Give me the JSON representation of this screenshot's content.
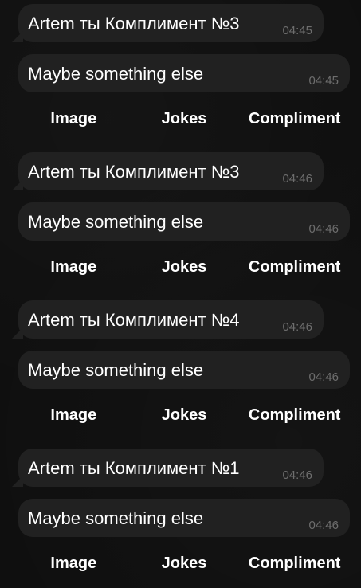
{
  "groups": [
    {
      "compliment": {
        "text": "Artem ты Комплимент №3",
        "time": "04:45"
      },
      "followup": {
        "text": "Maybe something else",
        "time": "04:45"
      },
      "buttons": [
        "Image",
        "Jokes",
        "Compliment"
      ]
    },
    {
      "compliment": {
        "text": "Artem ты Комплимент №3",
        "time": "04:46"
      },
      "followup": {
        "text": "Maybe something else",
        "time": "04:46"
      },
      "buttons": [
        "Image",
        "Jokes",
        "Compliment"
      ]
    },
    {
      "compliment": {
        "text": "Artem ты Комплимент №4",
        "time": "04:46"
      },
      "followup": {
        "text": "Maybe something else",
        "time": "04:46"
      },
      "buttons": [
        "Image",
        "Jokes",
        "Compliment"
      ]
    },
    {
      "compliment": {
        "text": "Artem ты Комплимент №1",
        "time": "04:46"
      },
      "followup": {
        "text": "Maybe something else",
        "time": "04:46"
      },
      "buttons": [
        "Image",
        "Jokes",
        "Compliment"
      ]
    }
  ]
}
